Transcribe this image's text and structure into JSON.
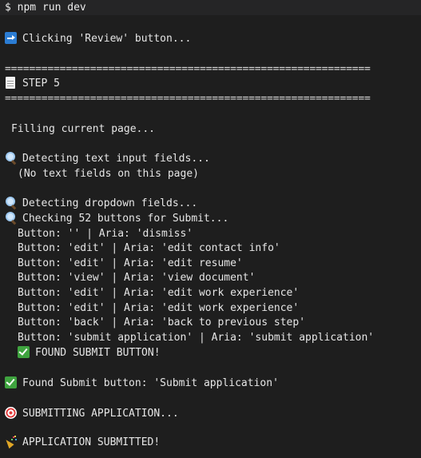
{
  "titlebar": {
    "command": "$ npm run dev"
  },
  "icons": {
    "arrow": "right-arrow-icon",
    "page": "page-icon",
    "search": "search-icon",
    "check": "check-icon",
    "target": "target-icon",
    "party": "party-popper-icon"
  },
  "colors": {
    "background": "#1e1e1e",
    "text": "#e6e6e6",
    "arrow_icon": "#2b7cd3",
    "check_icon": "#3fa33f"
  },
  "terminal": {
    "clicking_review": "Clicking 'Review' button...",
    "separator": "============================================================",
    "step_label": "STEP 5",
    "filling_page": "Filling current page...",
    "detecting_text": "Detecting text input fields...",
    "no_text_fields": "(No text fields on this page)",
    "detecting_dropdown": "Detecting dropdown fields...",
    "checking_buttons": "Checking 52 buttons for Submit...",
    "buttons": [
      "Button: '' | Aria: 'dismiss'",
      "Button: 'edit' | Aria: 'edit contact info'",
      "Button: 'edit' | Aria: 'edit resume'",
      "Button: 'view' | Aria: 'view document'",
      "Button: 'edit' | Aria: 'edit work experience'",
      "Button: 'edit' | Aria: 'edit work experience'",
      "Button: 'back' | Aria: 'back to previous step'",
      "Button: 'submit application' | Aria: 'submit application'"
    ],
    "found_submit": "FOUND SUBMIT BUTTON!",
    "found_submit_button": "Found Submit button: 'Submit application'",
    "submitting": "SUBMITTING APPLICATION...",
    "submitted": "APPLICATION SUBMITTED!"
  }
}
